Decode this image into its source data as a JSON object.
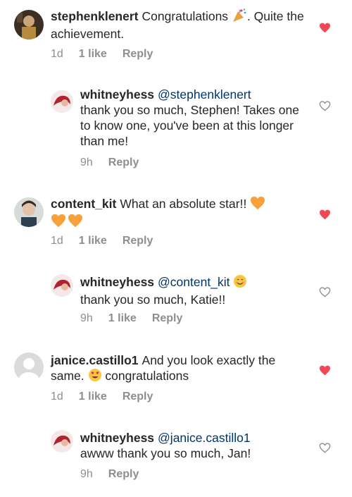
{
  "colors": {
    "heart_liked": "#ed4956",
    "heart_outline": "#8e8e8e",
    "mention": "#003569",
    "meta": "#8e8e8e",
    "orange_heart": "#f7a13a"
  },
  "comments": [
    {
      "user": "stephenklenert",
      "text_before": "Congratulations",
      "text_after": ". Quite the achievement.",
      "emoji": "party-popper",
      "age": "1d",
      "likes": "1 like",
      "reply": "Reply",
      "liked": true
    },
    {
      "user": "whitneyhess",
      "mention": "@stephenklenert",
      "text": "thank you so much, Stephen! Takes one to know one, you've been at this longer than me!",
      "age": "9h",
      "reply": "Reply",
      "liked": false
    },
    {
      "user": "content_kit",
      "text": "What an absolute star!!",
      "emoji": "orange-heart",
      "age": "1d",
      "likes": "1 like",
      "reply": "Reply",
      "liked": true
    },
    {
      "user": "whitneyhess",
      "mention": "@content_kit",
      "text": "thank you so much, Katie!!",
      "emoji": "smiling-face",
      "age": "9h",
      "likes": "1 like",
      "reply": "Reply",
      "liked": false
    },
    {
      "user": "janice.castillo1",
      "text_before": "And you look exactly the same.",
      "text_after": "congratulations",
      "emoji": "heart-eyes",
      "age": "1d",
      "likes": "1 like",
      "reply": "Reply",
      "liked": true
    },
    {
      "user": "whitneyhess",
      "mention": "@janice.castillo1",
      "text": "awww thank you so much, Jan!",
      "age": "9h",
      "reply": "Reply",
      "liked": false
    }
  ]
}
